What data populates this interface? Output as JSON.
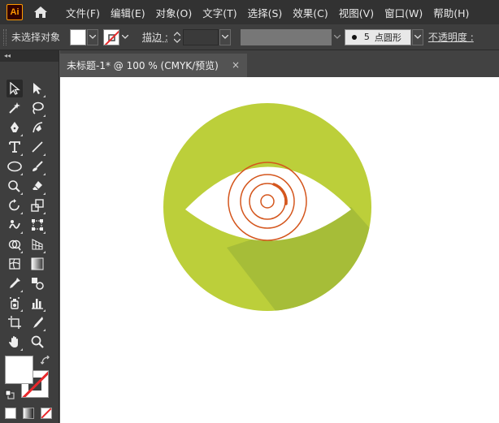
{
  "app": {
    "logo_text": "Ai",
    "accent_color": "#ff9a00"
  },
  "menu": [
    "文件(F)",
    "编辑(E)",
    "对象(O)",
    "文字(T)",
    "选择(S)",
    "效果(C)",
    "视图(V)",
    "窗口(W)",
    "帮助(H)"
  ],
  "control_bar": {
    "selection_label": "未选择对象",
    "stroke_label": "描边 :",
    "brush_size": "5",
    "brush_shape": "点圆形",
    "opacity_label": "不透明度 :"
  },
  "toolpanel": {
    "collapse_glyph": "◂◂"
  },
  "document": {
    "tab_title": "未标题-1* @ 100 % (CMYK/预览)",
    "close_glyph": "×"
  },
  "artwork": {
    "circle_color": "#bccf3a",
    "shadow_color": "#a6bd38",
    "eye_color": "#ffffff",
    "iris_color": "#d4561d"
  },
  "icons": {
    "home": "home-icon",
    "selection": "selection-arrow-icon",
    "direct_selection": "direct-selection-icon",
    "magic_wand": "magic-wand-icon",
    "lasso": "lasso-icon",
    "pen": "pen-icon",
    "curvature": "curvature-icon",
    "type": "type-icon",
    "line": "line-segment-icon",
    "ellipse": "ellipse-icon",
    "paintbrush": "paintbrush-icon",
    "shaper": "shaper-icon",
    "eraser": "eraser-icon",
    "rotate": "rotate-icon",
    "scale": "scale-icon",
    "warp": "warp-icon",
    "free_transform": "free-transform-icon",
    "shape_builder": "shape-builder-icon",
    "perspective": "perspective-grid-icon",
    "mesh": "mesh-icon",
    "gradient": "gradient-icon",
    "eyedropper": "eyedropper-icon",
    "blend": "blend-icon",
    "symbol_sprayer": "symbol-sprayer-icon",
    "graph": "column-graph-icon",
    "artboard": "artboard-icon",
    "slice": "slice-icon",
    "hand": "hand-icon",
    "zoom": "zoom-icon"
  }
}
